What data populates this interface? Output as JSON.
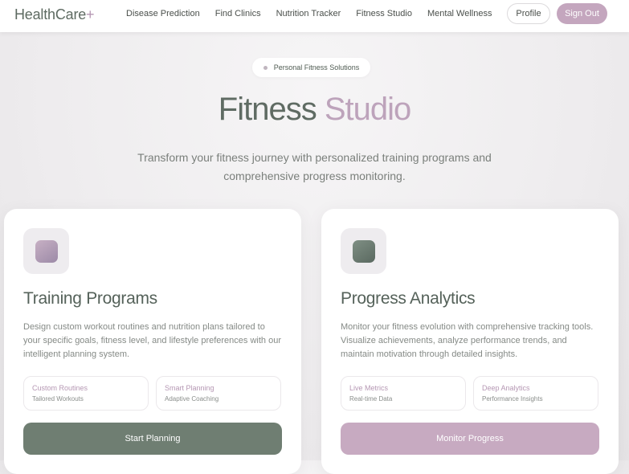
{
  "nav": {
    "logo_text": "HealthCare",
    "logo_plus": "+",
    "links": [
      "Disease Prediction",
      "Find Clinics",
      "Nutrition Tracker",
      "Fitness Studio",
      "Mental Wellness"
    ],
    "profile_label": "Profile",
    "signout_label": "Sign Out"
  },
  "hero": {
    "pill_label": "Personal Fitness Solutions",
    "title_main": "Fitness ",
    "title_accent": "Studio",
    "subtitle_line1": "Transform your fitness journey with personalized training programs and",
    "subtitle_line2": "comprehensive progress monitoring."
  },
  "cards": [
    {
      "title": "Training Programs",
      "desc_lines": [
        "Design custom workout routines and nutrition plans tailored to",
        "your specific goals, fitness level, and lifestyle preferences with our",
        "intelligent planning system."
      ],
      "features": [
        {
          "title": "Custom Routines",
          "sub": "Tailored Workouts"
        },
        {
          "title": "Smart Planning",
          "sub": "Adaptive Coaching"
        }
      ],
      "cta": "Start Planning"
    },
    {
      "title": "Progress Analytics",
      "desc_lines": [
        "Monitor your fitness evolution with comprehensive tracking tools.",
        "Visualize achievements, analyze performance trends, and",
        "maintain motivation through detailed insights."
      ],
      "features": [
        {
          "title": "Live Metrics",
          "sub": "Real-time Data"
        },
        {
          "title": "Deep Analytics",
          "sub": "Performance Insights"
        }
      ],
      "cta": "Monitor Progress"
    }
  ],
  "colors": {
    "sage": "#6f7e72",
    "lavender": "#c7aac1",
    "accent_text": "#b597b3"
  }
}
